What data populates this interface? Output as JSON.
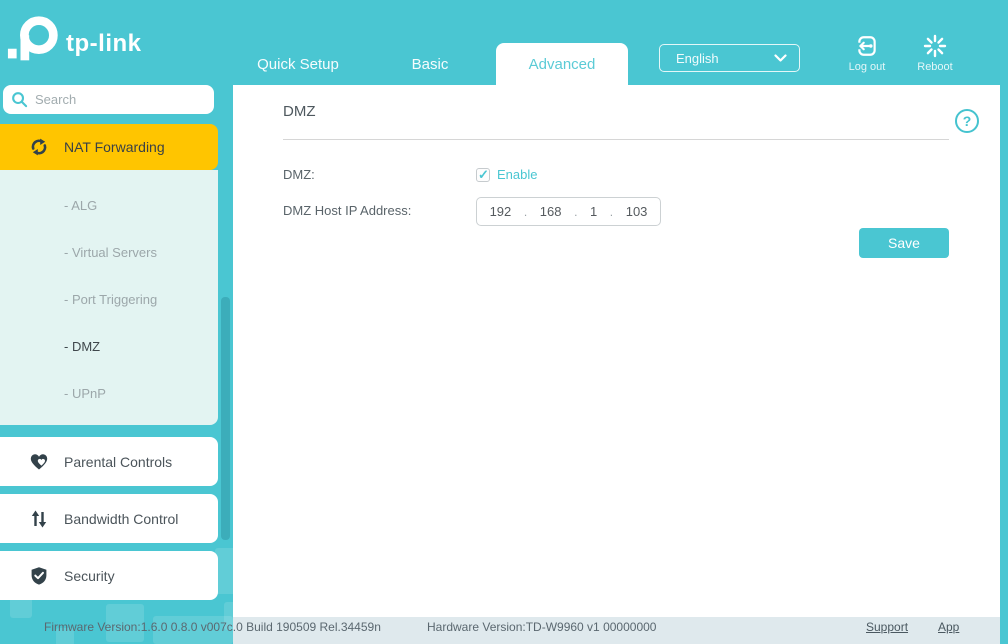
{
  "brand": {
    "logo_text": "tp-link"
  },
  "header": {
    "tabs": [
      {
        "label": "Quick Setup",
        "active": false
      },
      {
        "label": "Basic",
        "active": false
      },
      {
        "label": "Advanced",
        "active": true
      }
    ],
    "language": {
      "selected": "English"
    },
    "actions": [
      {
        "label": "Log out",
        "icon": "logout-icon"
      },
      {
        "label": "Reboot",
        "icon": "reboot-icon"
      }
    ]
  },
  "sidebar": {
    "search_placeholder": "Search",
    "sections": [
      {
        "label": "NAT Forwarding",
        "icon": "nat-forwarding-icon",
        "active": true,
        "children": [
          {
            "label": "- ALG",
            "active": false
          },
          {
            "label": "- Virtual Servers",
            "active": false
          },
          {
            "label": "- Port Triggering",
            "active": false
          },
          {
            "label": "- DMZ",
            "active": true
          },
          {
            "label": "- UPnP",
            "active": false
          }
        ]
      },
      {
        "label": "Parental Controls",
        "icon": "parental-controls-icon",
        "active": false
      },
      {
        "label": "Bandwidth Control",
        "icon": "bandwidth-control-icon",
        "active": false
      },
      {
        "label": "Security",
        "icon": "security-icon",
        "active": false
      }
    ]
  },
  "main": {
    "title": "DMZ",
    "help_glyph": "?",
    "dmz_label": "DMZ:",
    "enable_label": "Enable",
    "enable_checked": true,
    "host_ip_label": "DMZ Host IP Address:",
    "ip_octets": [
      "192",
      "168",
      "1",
      "103"
    ],
    "ip_separator": ".",
    "save_label": "Save"
  },
  "footer": {
    "firmware": "Firmware Version:1.6.0 0.8.0 v007c.0 Build 190509 Rel.34459n",
    "hardware": "Hardware Version:TD-W9960 v1 00000000",
    "links": [
      {
        "label": "Support"
      },
      {
        "label": "App"
      }
    ]
  },
  "icons": {
    "check_glyph": "✓"
  },
  "colors": {
    "accent_teal": "#4ac6d2",
    "active_yellow": "#ffc500",
    "subpanel_mint": "#e3f4f2",
    "footer_band": "#dfe9ed",
    "dark_icon": "#33424a",
    "scrollbar_teal": "#3cadba"
  }
}
